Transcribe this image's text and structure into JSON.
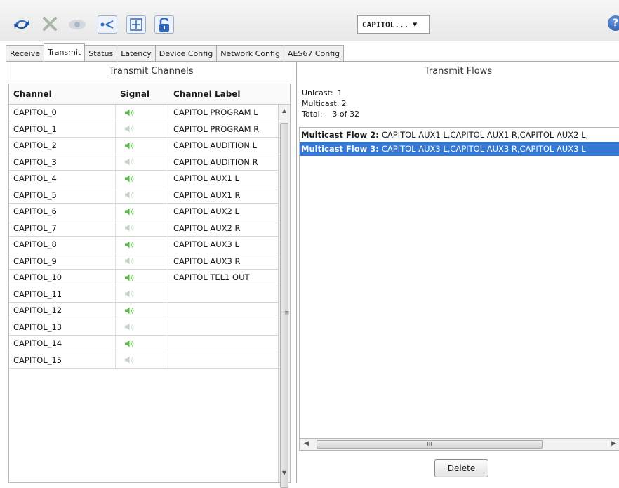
{
  "toolbar": {
    "icons": [
      "refresh-icon",
      "tools-icon",
      "eye-icon",
      "network-share-icon",
      "add-icon",
      "unlock-icon"
    ],
    "device": "CAPITOL...",
    "help": "?"
  },
  "tabs": [
    "Receive",
    "Transmit",
    "Status",
    "Latency",
    "Device Config",
    "Network Config",
    "AES67 Config"
  ],
  "active_tab": "Transmit",
  "left": {
    "title": "Transmit Channels",
    "columns": [
      "Channel",
      "Signal",
      "Channel Label"
    ],
    "rows": [
      {
        "channel": "CAPITOL_0",
        "signal": "active",
        "label": "CAPITOL PROGRAM L"
      },
      {
        "channel": "CAPITOL_1",
        "signal": "inactive",
        "label": "CAPITOL PROGRAM R"
      },
      {
        "channel": "CAPITOL_2",
        "signal": "active",
        "label": "CAPITOL AUDITION L"
      },
      {
        "channel": "CAPITOL_3",
        "signal": "inactive",
        "label": "CAPITOL AUDITION R"
      },
      {
        "channel": "CAPITOL_4",
        "signal": "active",
        "label": "CAPITOL AUX1 L"
      },
      {
        "channel": "CAPITOL_5",
        "signal": "inactive",
        "label": "CAPITOL AUX1 R"
      },
      {
        "channel": "CAPITOL_6",
        "signal": "active",
        "label": "CAPITOL AUX2 L"
      },
      {
        "channel": "CAPITOL_7",
        "signal": "inactive",
        "label": "CAPITOL AUX2 R"
      },
      {
        "channel": "CAPITOL_8",
        "signal": "active",
        "label": "CAPITOL AUX3 L"
      },
      {
        "channel": "CAPITOL_9",
        "signal": "inactive",
        "label": "CAPITOL AUX3 R"
      },
      {
        "channel": "CAPITOL_10",
        "signal": "active",
        "label": "CAPITOL TEL1 OUT"
      },
      {
        "channel": "CAPITOL_11",
        "signal": "inactive",
        "label": ""
      },
      {
        "channel": "CAPITOL_12",
        "signal": "active",
        "label": ""
      },
      {
        "channel": "CAPITOL_13",
        "signal": "inactive",
        "label": ""
      },
      {
        "channel": "CAPITOL_14",
        "signal": "active",
        "label": ""
      },
      {
        "channel": "CAPITOL_15",
        "signal": "inactive",
        "label": ""
      }
    ]
  },
  "right": {
    "title": "Transmit Flows",
    "stats": {
      "unicast_label": "Unicast:",
      "unicast": "1",
      "multicast_label": "Multicast:",
      "multicast": "2",
      "total_label": "Total:",
      "total": "3 of 32"
    },
    "flows": [
      {
        "name": "Multicast Flow 2:",
        "channels": "CAPITOL AUX1 L,CAPITOL AUX1 R,CAPITOL AUX2 L,",
        "selected": false
      },
      {
        "name": "Multicast Flow 3:",
        "channels": "CAPITOL AUX3 L,CAPITOL AUX3 R,CAPITOL AUX3 L",
        "selected": true
      }
    ],
    "hscroll_grip": "III",
    "delete_label": "Delete"
  },
  "colors": {
    "signal_active": "#58b848",
    "signal_inactive": "#c6d2c6",
    "selection": "#3478d4"
  }
}
